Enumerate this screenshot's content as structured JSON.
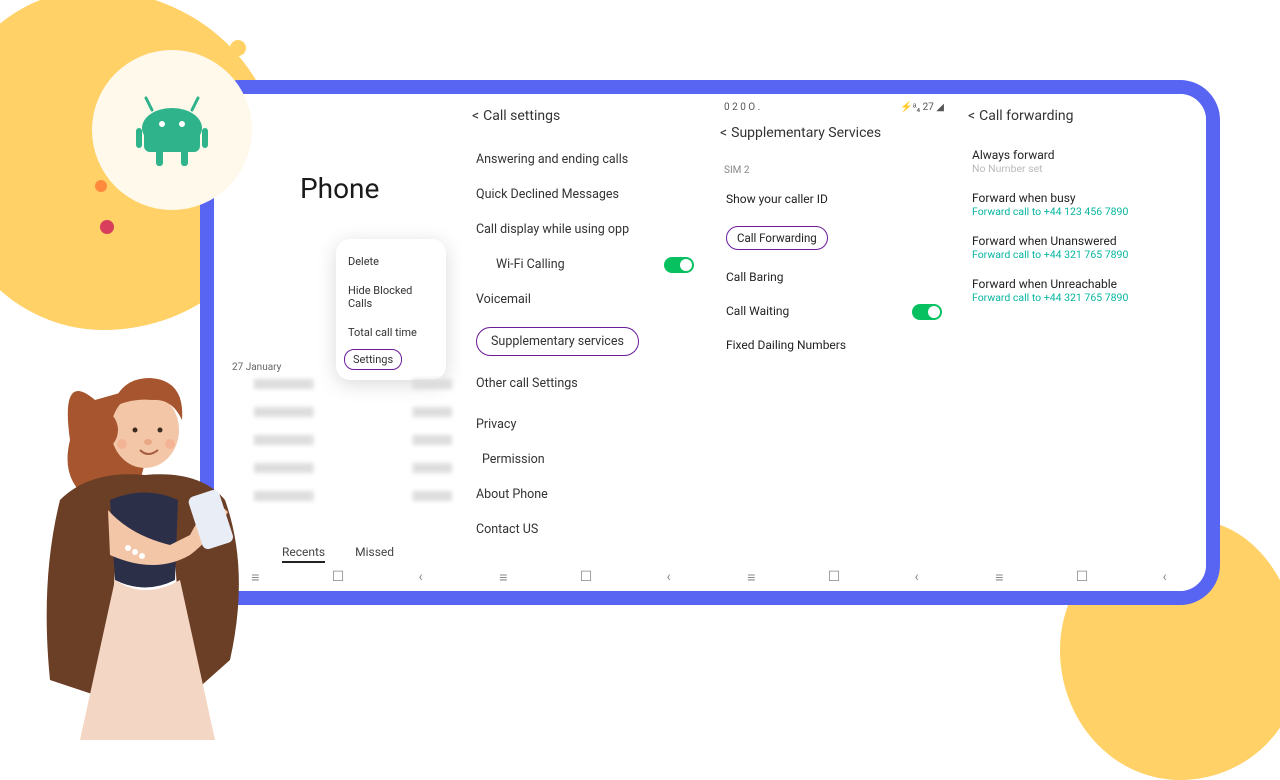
{
  "screen1": {
    "title": "Phone",
    "menu": [
      "Delete",
      "Hide Blocked Calls",
      "Total call time",
      "Settings"
    ],
    "date": "27 January",
    "tabs": {
      "recents": "Recents",
      "missed": "Missed"
    }
  },
  "screen2": {
    "header": "Call settings",
    "rows": {
      "answering": "Answering and ending calls",
      "declined": "Quick Declined Messages",
      "display": "Call display while using opp",
      "wifi": "Wi-Fi Calling",
      "voicemail": "Voicemail",
      "supplementary": "Supplementary services",
      "other": "Other call Settings",
      "privacy": "Privacy",
      "permission": "Permission",
      "about": "About Phone",
      "contact": "Contact US"
    }
  },
  "screen3": {
    "statusLeft": "0 2 0   O .",
    "statusRight": "⚡ᵃ₄ 27 ◢",
    "header": "Supplementary Services",
    "sim": "SIM 2",
    "rows": {
      "caller": "Show your caller ID",
      "forwarding": "Call Forwarding",
      "baring": "Call Baring",
      "waiting": "Call Waiting",
      "fixed": "Fixed Dailing Numbers"
    }
  },
  "screen4": {
    "header": "Call forwarding",
    "items": [
      {
        "title": "Always forward",
        "sub": "No Number set",
        "muted": true
      },
      {
        "title": "Forward when busy",
        "sub": "Forward call to +44 123 456 7890"
      },
      {
        "title": "Forward when Unanswered",
        "sub": "Forward call to +44 321 765 7890"
      },
      {
        "title": "Forward when Unreachable",
        "sub": "Forward call to +44 321 765 7890"
      }
    ]
  }
}
